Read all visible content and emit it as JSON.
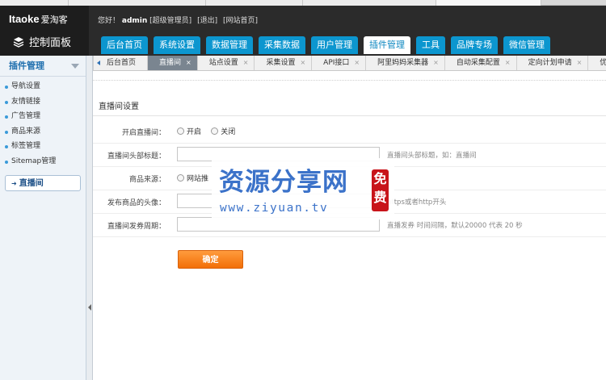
{
  "brand": {
    "logo": "Itaoke",
    "logo_cn": "爱淘客",
    "panel": "控制面板"
  },
  "header": {
    "greeting": "您好！",
    "user": "admin",
    "role": "[超级管理员]",
    "logout": "[退出]",
    "site_home": "[网站首页]"
  },
  "nav": {
    "tabs": [
      "后台首页",
      "系统设置",
      "数据管理",
      "采集数据",
      "用户管理",
      "插件管理",
      "工具",
      "品牌专场",
      "微信管理"
    ],
    "active": "插件管理"
  },
  "sidebar": {
    "title": "插件管理",
    "items": [
      "导航设置",
      "友情链接",
      "广告管理",
      "商品来源",
      "标签管理",
      "Sitemap管理"
    ],
    "active": "直播间"
  },
  "tabbar": {
    "tabs": [
      "后台首页",
      "直播间",
      "站点设置",
      "采集设置",
      "API接口",
      "阿里妈妈采集器",
      "自动采集配置",
      "定向计划申请",
      "优"
    ],
    "active": "直播间",
    "close_glyph": "×"
  },
  "form": {
    "section_title": "直播间设置",
    "enable_label": "开启直播间：",
    "enable_on": "开启",
    "enable_off": "关闭",
    "title_label": "直播间头部标题：",
    "title_value": "",
    "title_hint": "直播间头部标题，如：直播间",
    "source_label": "商品来源：",
    "source_option": "网站推",
    "avatar_label": "发布商品的头像：",
    "avatar_value": "",
    "avatar_hint": "https或者http开头",
    "period_label": "直播间发券周期：",
    "period_value": "",
    "period_hint": "直播发券 时间间隔，默认20000 代表 20 秒",
    "submit": "确定"
  },
  "watermark": {
    "text": "资源分享网",
    "stamp": "免费",
    "url": "www.ziyuan.tv"
  },
  "colors": {
    "nav_blue": "#0c96cf",
    "submit_orange": "#f26f07",
    "watermark_blue": "#3b72c9",
    "stamp_red": "#c8141a"
  }
}
